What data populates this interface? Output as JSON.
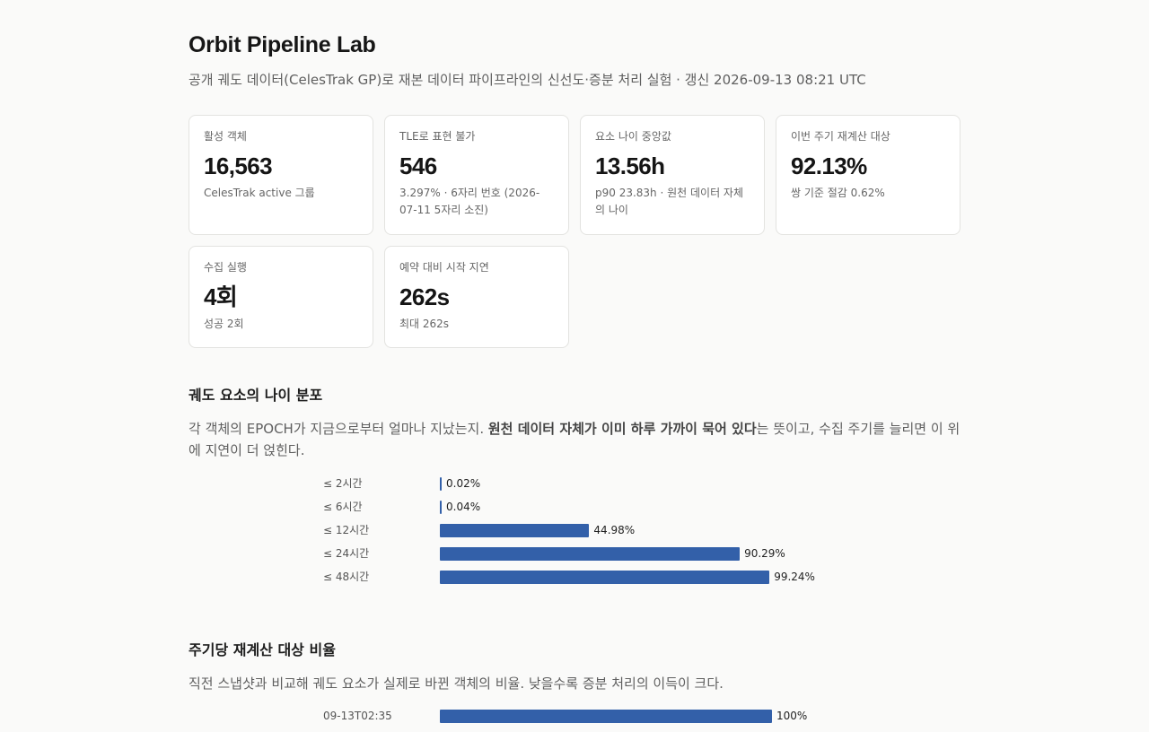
{
  "header": {
    "title": "Orbit Pipeline Lab",
    "subtitle": "공개 궤도 데이터(CelesTrak GP)로 재본 데이터 파이프라인의 신선도·증분 처리 실험 · 갱신 2026-09-13 08:21 UTC"
  },
  "stats": [
    {
      "label": "활성 객체",
      "value": "16,563",
      "note": "CelesTrak active 그룹"
    },
    {
      "label": "TLE로 표현 불가",
      "value": "546",
      "note": "3.297% · 6자리 번호 (2026-07-11 5자리 소진)"
    },
    {
      "label": "요소 나이 중앙값",
      "value": "13.56h",
      "note": "p90 23.83h · 원천 데이터 자체의 나이"
    },
    {
      "label": "이번 주기 재계산 대상",
      "value": "92.13%",
      "note": "쌍 기준 절감 0.62%"
    },
    {
      "label": "수집 실행",
      "value": "4회",
      "note": "성공 2회"
    },
    {
      "label": "예약 대비 시작 지연",
      "value": "262s",
      "note": "최대 262s"
    }
  ],
  "age_section": {
    "title": "궤도 요소의 나이 분포",
    "desc_before": "각 객체의 EPOCH가 지금으로부터 얼마나 지났는지. ",
    "desc_strong": "원천 데이터 자체가 이미 하루 가까이 묵어 있다",
    "desc_after": "는 뜻이고, 수집 주기를 늘리면 이 위에 지연이 더 얹힌다."
  },
  "recompute_section": {
    "title": "주기당 재계산 대상 비율",
    "desc": "직전 스냅샷과 비교해 궤도 요소가 실제로 바뀐 객체의 비율. 낮을수록 증분 처리의 이득이 크다."
  },
  "chart_data": [
    {
      "type": "bar",
      "orientation": "horizontal",
      "categories": [
        "≤ 2시간",
        "≤ 6시간",
        "≤ 12시간",
        "≤ 24시간",
        "≤ 48시간"
      ],
      "values": [
        0.02,
        0.04,
        44.98,
        90.29,
        99.24
      ],
      "value_labels": [
        "0.02%",
        "0.04%",
        "44.98%",
        "90.29%",
        "99.24%"
      ],
      "xlim": [
        0,
        100
      ],
      "color": "#3360a9"
    },
    {
      "type": "bar",
      "orientation": "horizontal",
      "categories": [
        "09-13T02:35"
      ],
      "values": [
        100
      ],
      "value_labels": [
        "100%"
      ],
      "xlim": [
        0,
        100
      ],
      "color": "#3360a9"
    }
  ]
}
